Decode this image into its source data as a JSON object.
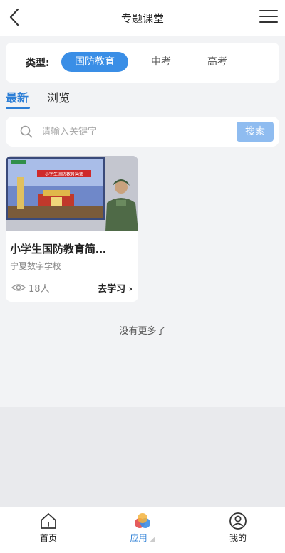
{
  "header": {
    "title": "专题课堂"
  },
  "type_filter": {
    "label": "类型:",
    "options": [
      {
        "label": "国防教育",
        "selected": true
      },
      {
        "label": "中考",
        "selected": false
      },
      {
        "label": "高考",
        "selected": false
      }
    ]
  },
  "tabs": [
    {
      "label": "最新",
      "active": true
    },
    {
      "label": "浏览",
      "active": false
    }
  ],
  "search": {
    "placeholder": "请输入关键字",
    "button_label": "搜索"
  },
  "courses": [
    {
      "title": "小学生国防教育简…",
      "school": "宁夏数字学校",
      "views": "18人",
      "action": "去学习",
      "thumb_caption": "小学生国防教育简要"
    }
  ],
  "list_end_text": "没有更多了",
  "bottom_nav": [
    {
      "label": "首页",
      "icon": "home-icon",
      "active": false
    },
    {
      "label": "应用",
      "icon": "apps-icon",
      "active": true
    },
    {
      "label": "我的",
      "icon": "profile-icon",
      "active": false
    }
  ],
  "colors": {
    "accent": "#2d7fd6",
    "chip_active": "#3a8ee6",
    "search_button": "#8fbcf0"
  }
}
